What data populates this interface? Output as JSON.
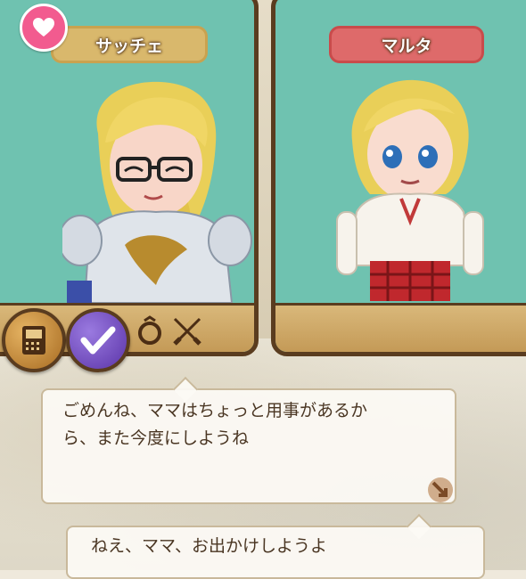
{
  "characters": {
    "left": {
      "name": "サッチェ",
      "plate_color": "#d9b86c"
    },
    "right": {
      "name": "マルタ",
      "plate_color": "#de6a6a"
    }
  },
  "badges": {
    "heart": "heart-icon"
  },
  "actions": [
    {
      "icon": "book-icon"
    },
    {
      "icon": "check-icon"
    },
    {
      "icon": "ring-icon"
    },
    {
      "icon": "crossed-swords-icon"
    }
  ],
  "dialog": {
    "line1": "ごめんね、ママはちょっと用事があるか",
    "line2": "ら、また今度にしようね"
  },
  "reply": {
    "text": "ねえ、ママ、お出かけしようよ"
  },
  "colors": {
    "panel_bg": "#6fc2b0",
    "frame": "#5a3c1f",
    "floor": "#d9b87a"
  }
}
